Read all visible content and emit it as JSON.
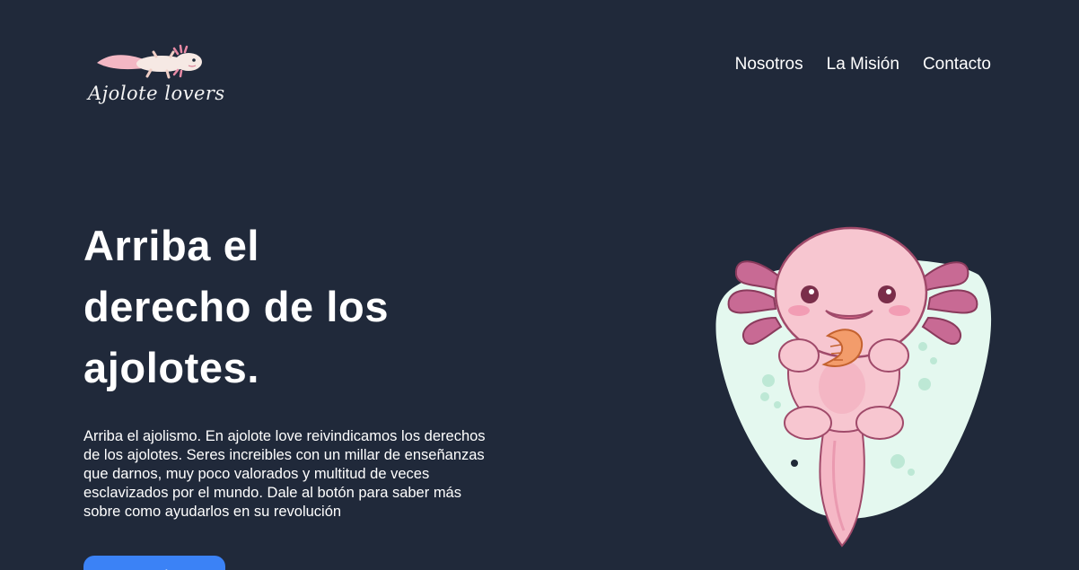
{
  "header": {
    "logo_text": "Ajolote lovers",
    "nav": [
      {
        "label": "Nosotros"
      },
      {
        "label": "La Misión"
      },
      {
        "label": "Contacto"
      }
    ]
  },
  "hero": {
    "title_lines": [
      "Arriba el",
      "derecho de los",
      "ajolotes."
    ],
    "description": "Arriba el ajolismo. En ajolote love reivindicamos los derechos de los ajolotes. Seres increibles con un millar de enseñanzas que darnos, muy poco valorados y multitud de veces esclavizados por el mundo. Dale al botón para saber más sobre como ayudarlos en su revolución",
    "cta_label": "Ayuda"
  },
  "colors": {
    "background": "#20293a",
    "accent": "#3b82f6",
    "axolotl_body": "#f7c6d0",
    "axolotl_gills": "#c86a94",
    "blob": "#e4f8ef"
  },
  "icons": {
    "logo": "axolotl-logo-icon",
    "illustration": "axolotl-illustration"
  }
}
